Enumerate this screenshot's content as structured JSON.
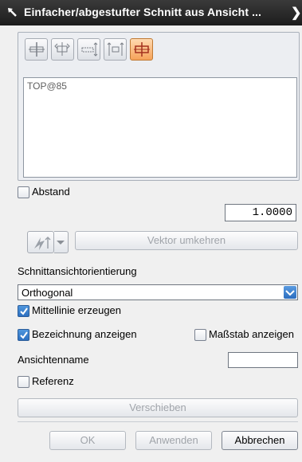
{
  "window": {
    "title": "Einfacher/abgestufter Schnitt aus Ansicht ..."
  },
  "toolbar": {
    "buttons": [
      {
        "icon": "section-line-icon",
        "active": false
      },
      {
        "icon": "hinge-line-icon",
        "active": false
      },
      {
        "icon": "stepped-section-icon",
        "active": false
      },
      {
        "icon": "section-arrows-icon",
        "active": false
      },
      {
        "icon": "cut-position-icon",
        "active": true
      }
    ]
  },
  "list": {
    "items": [
      "TOP@85"
    ]
  },
  "distance": {
    "label": "Abstand",
    "checked": false,
    "value": "1.0000"
  },
  "vector": {
    "reverse_label": "Vektor umkehren"
  },
  "orientation": {
    "label": "Schnittansichtorientierung",
    "selected": "Orthogonal"
  },
  "centerline": {
    "label": "Mittellinie erzeugen",
    "checked": true
  },
  "show_label": {
    "label": "Bezeichnung anzeigen",
    "checked": true
  },
  "show_scale": {
    "label": "Maßstab anzeigen",
    "checked": false
  },
  "view_name": {
    "label": "Ansichtenname",
    "value": ""
  },
  "reference": {
    "label": "Referenz",
    "checked": false
  },
  "move_button": "Verschieben",
  "footer": {
    "ok": "OK",
    "apply": "Anwenden",
    "cancel": "Abbrechen"
  },
  "colors": {
    "titlebar": "#2a2a2a",
    "accent": "#2c6fc0",
    "active_tool": "#f6a35a"
  }
}
